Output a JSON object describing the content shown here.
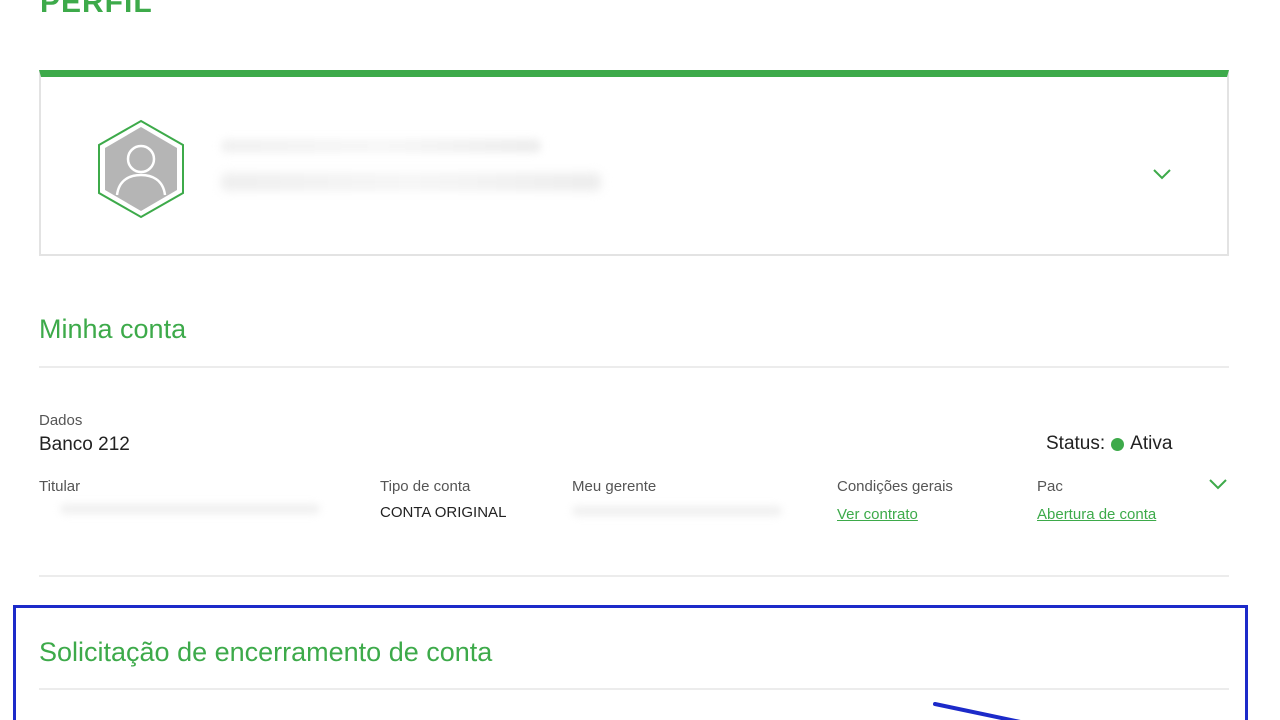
{
  "page": {
    "title": "PERFIL"
  },
  "account_section": {
    "title": "Minha conta",
    "dados_label": "Dados",
    "bank_name": "Banco 212",
    "status_label": "Status:",
    "status_value": "Ativa",
    "status_color": "#3daa4a",
    "titular_label": "Titular",
    "tipo_label": "Tipo de conta",
    "tipo_value": "CONTA ORIGINAL",
    "gerente_label": "Meu gerente",
    "condicoes_label": "Condições gerais",
    "condicoes_link": "Ver contrato",
    "pac_label": "Pac",
    "pac_link": "Abertura de conta"
  },
  "closure_section": {
    "title": "Solicitação de encerramento de conta"
  },
  "icons": {
    "avatar": "user-avatar-hexagon-icon",
    "expand": "chevron-down-icon"
  },
  "colors": {
    "accent": "#3daa4a",
    "highlight": "#1c2ac9"
  }
}
